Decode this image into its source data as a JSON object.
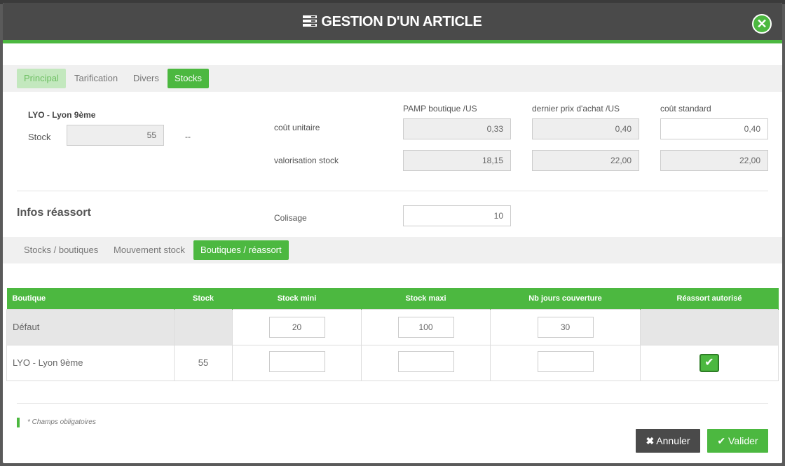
{
  "modal": {
    "title": "GESTION D'UN ARTICLE",
    "close_icon": "close-circle-icon"
  },
  "tabs": [
    {
      "label": "Principal",
      "state": "light"
    },
    {
      "label": "Tarification",
      "state": "normal"
    },
    {
      "label": "Divers",
      "state": "normal"
    },
    {
      "label": "Stocks",
      "state": "active"
    }
  ],
  "stock_block": {
    "store_name": "LYO - Lyon 9ème",
    "stock_label": "Stock",
    "stock_value": "55",
    "dash": "--"
  },
  "cost": {
    "headers": [
      "PAMP boutique /US",
      "dernier prix d'achat /US",
      "coût standard"
    ],
    "unit_cost_label": "coût unitaire",
    "unit_cost": [
      "0,33",
      "0,40",
      "0,40"
    ],
    "valuation_label": "valorisation stock",
    "valuation": [
      "18,15",
      "22,00",
      "22,00"
    ]
  },
  "reassort": {
    "title": "Infos réassort",
    "colisage_label": "Colisage",
    "colisage_value": "10"
  },
  "subtabs": [
    {
      "label": "Stocks / boutiques",
      "state": "normal"
    },
    {
      "label": "Mouvement stock",
      "state": "normal"
    },
    {
      "label": "Boutiques / réassort",
      "state": "active"
    }
  ],
  "table": {
    "columns": [
      "Boutique",
      "Stock",
      "Stock mini",
      "Stock maxi",
      "Nb jours couverture",
      "Réassort autorisé"
    ],
    "rows": [
      {
        "boutique": "Défaut",
        "stock": "",
        "stock_mini": "20",
        "stock_maxi": "100",
        "nb_jours": "30",
        "reassort": ""
      },
      {
        "boutique": "LYO - Lyon 9ème",
        "stock": "55",
        "stock_mini": "",
        "stock_maxi": "",
        "nb_jours": "",
        "reassort": "checked"
      }
    ]
  },
  "footer": {
    "note": "* Champs obligatoires",
    "cancel_label": "Annuler",
    "ok_label": "Valider"
  },
  "colors": {
    "accent": "#4cb840",
    "header": "#4a4a4a"
  }
}
